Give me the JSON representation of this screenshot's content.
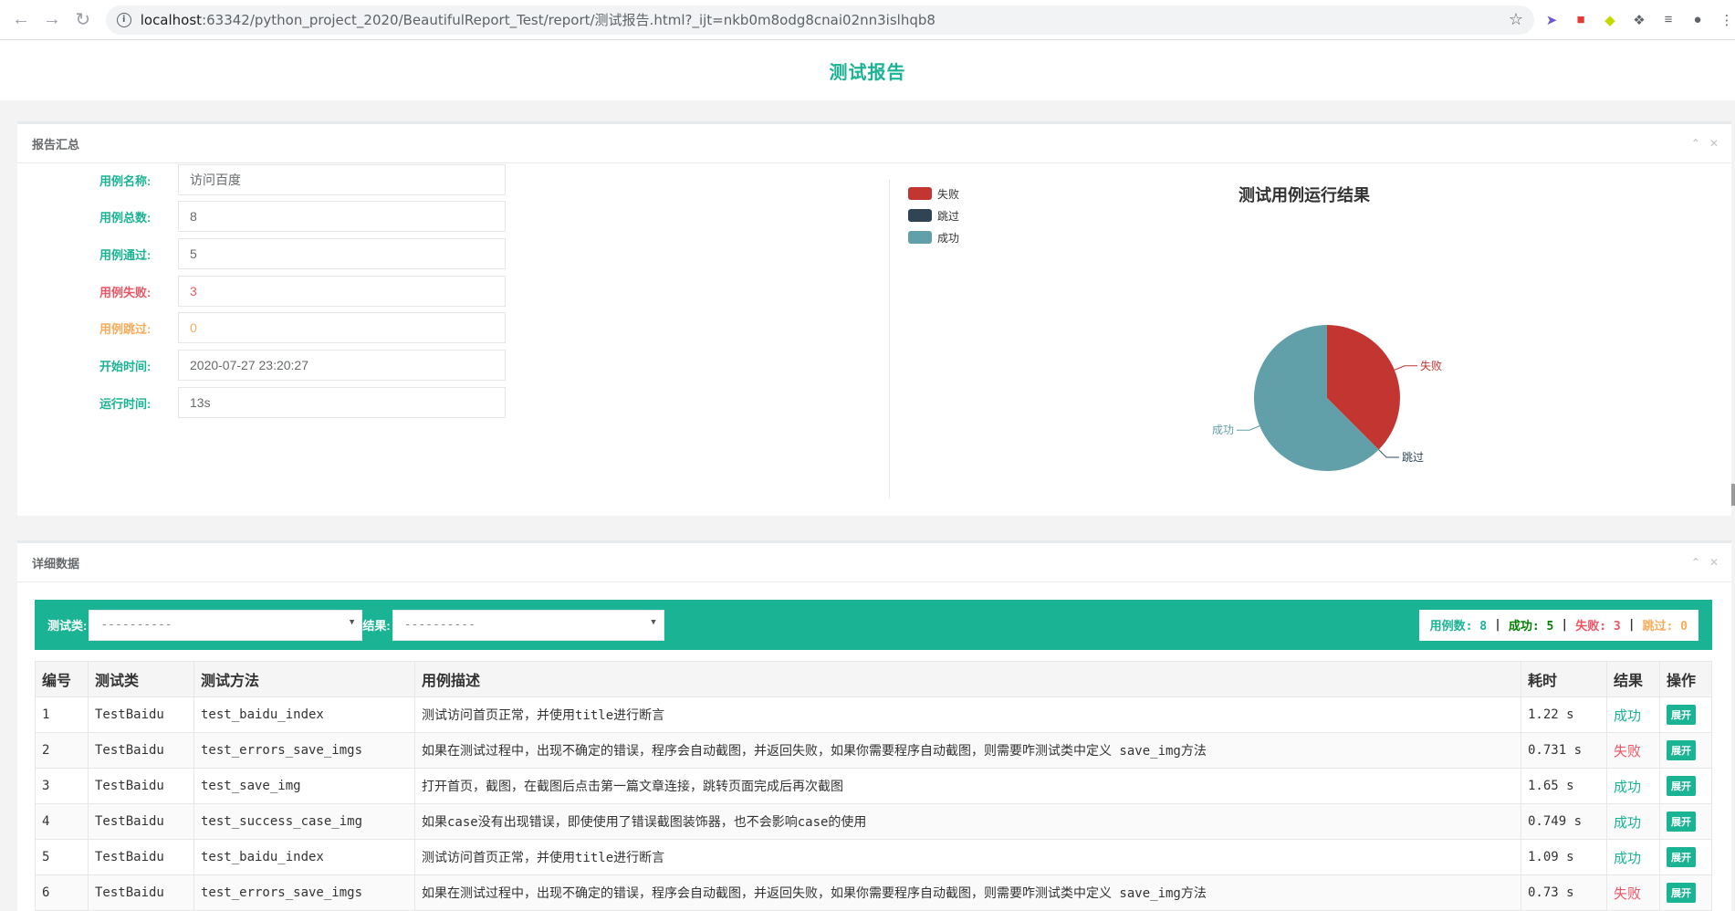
{
  "browser": {
    "url_host": "localhost",
    "url_path": ":63342/python_project_2020/BeautifulReport_Test/report/测试报告.html?_ijt=nkb0m8odg8cnai02nn3islhqb8"
  },
  "page": {
    "title": "测试报告"
  },
  "summary": {
    "panel_title": "报告汇总",
    "rows": [
      {
        "label": "用例名称:",
        "value": "访问百度"
      },
      {
        "label": "用例总数:",
        "value": "8"
      },
      {
        "label": "用例通过:",
        "value": "5"
      },
      {
        "label": "用例失败:",
        "value": "3"
      },
      {
        "label": "用例跳过:",
        "value": "0"
      },
      {
        "label": "开始时间:",
        "value": "2020-07-27 23:20:27"
      },
      {
        "label": "运行时间:",
        "value": "13s"
      }
    ]
  },
  "colors": {
    "accent": "#1ab394",
    "fail": "#c23531",
    "skip": "#2f4554",
    "pass": "#61a0a8"
  },
  "chart_data": {
    "type": "pie",
    "title": "测试用例运行结果",
    "legend": [
      "失败",
      "跳过",
      "成功"
    ],
    "series": [
      {
        "name": "失败",
        "value": 3,
        "color": "#c23531"
      },
      {
        "name": "跳过",
        "value": 0,
        "color": "#2f4554"
      },
      {
        "name": "成功",
        "value": 5,
        "color": "#61a0a8"
      }
    ]
  },
  "detail": {
    "panel_title": "详细数据",
    "filter": {
      "class_label": "测试类:",
      "class_value": "----------",
      "result_label": "结果:",
      "result_value": "----------"
    },
    "stats": {
      "total": "用例数: 8",
      "pass": "成功: 5",
      "fail": "失败: 3",
      "skip": "跳过: 0",
      "sep": "|"
    },
    "columns": [
      "编号",
      "测试类",
      "测试方法",
      "用例描述",
      "耗时",
      "结果",
      "操作"
    ],
    "rows": [
      {
        "no": "1",
        "cls": "TestBaidu",
        "method": "test_baidu_index",
        "desc": "测试访问首页正常，并使用title进行断言",
        "time": "1.22 s",
        "result": "成功",
        "action": "展开"
      },
      {
        "no": "2",
        "cls": "TestBaidu",
        "method": "test_errors_save_imgs",
        "desc": "如果在测试过程中，出现不确定的错误，程序会自动截图，并返回失败，如果你需要程序自动截图，则需要咋测试类中定义 save_img方法",
        "time": "0.731 s",
        "result": "失败",
        "action": "展开"
      },
      {
        "no": "3",
        "cls": "TestBaidu",
        "method": "test_save_img",
        "desc": "打开首页，截图，在截图后点击第一篇文章连接，跳转页面完成后再次截图",
        "time": "1.65 s",
        "result": "成功",
        "action": "展开"
      },
      {
        "no": "4",
        "cls": "TestBaidu",
        "method": "test_success_case_img",
        "desc": "如果case没有出现错误，即使使用了错误截图装饰器，也不会影响case的使用",
        "time": "0.749 s",
        "result": "成功",
        "action": "展开"
      },
      {
        "no": "5",
        "cls": "TestBaidu",
        "method": "test_baidu_index",
        "desc": "测试访问首页正常，并使用title进行断言",
        "time": "1.09 s",
        "result": "成功",
        "action": "展开"
      },
      {
        "no": "6",
        "cls": "TestBaidu",
        "method": "test_errors_save_imgs",
        "desc": "如果在测试过程中，出现不确定的错误，程序会自动截图，并返回失败，如果你需要程序自动截图，则需要咋测试类中定义 save_img方法",
        "time": "0.73 s",
        "result": "失败",
        "action": "展开"
      }
    ]
  }
}
